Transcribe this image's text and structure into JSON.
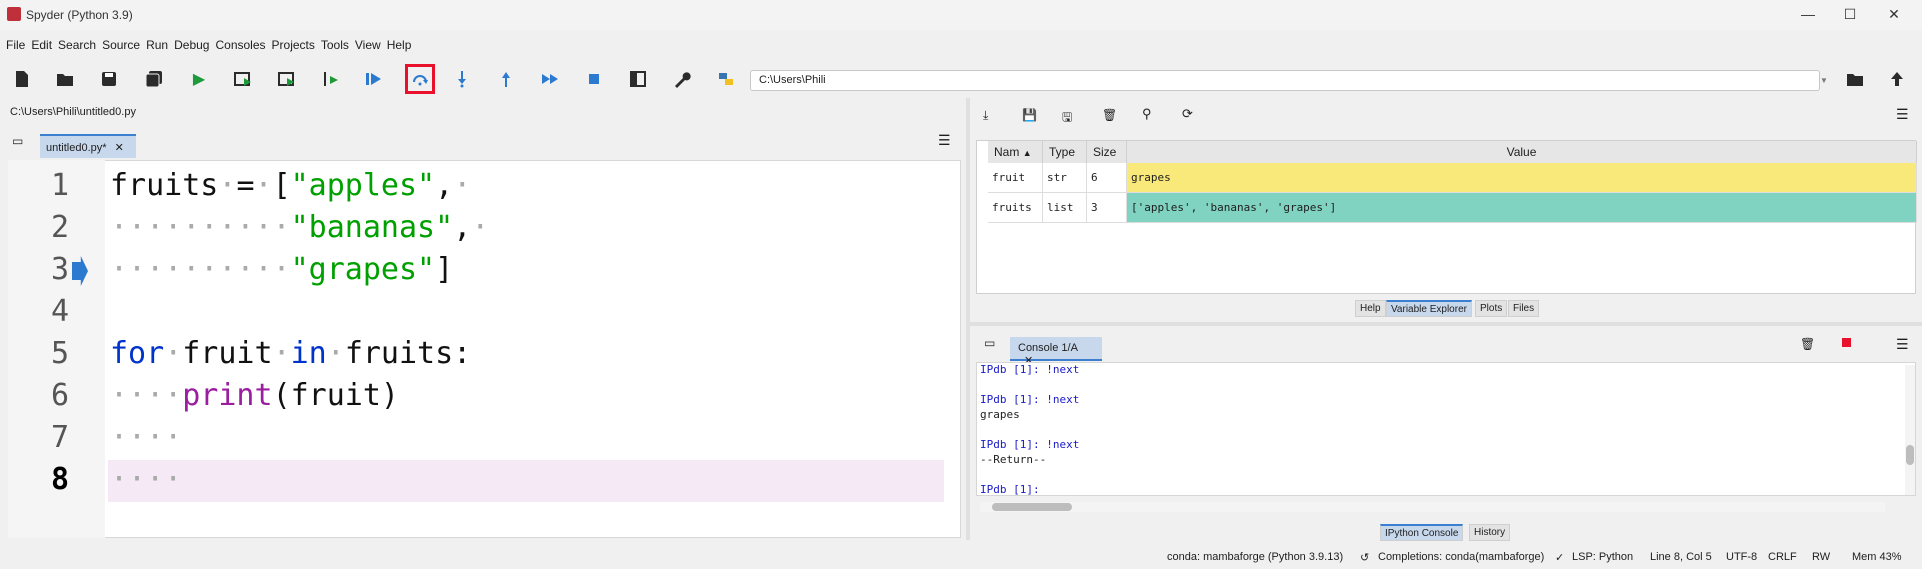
{
  "window": {
    "title": "Spyder (Python 3.9)"
  },
  "menu": [
    "File",
    "Edit",
    "Search",
    "Source",
    "Run",
    "Debug",
    "Consoles",
    "Projects",
    "Tools",
    "View",
    "Help"
  ],
  "toolbar": {
    "path": "C:\\Users\\Phili"
  },
  "editor": {
    "file_path": "C:\\Users\\Phili\\untitled0.py",
    "tab_label": "untitled0.py*",
    "line_numbers": [
      "1",
      "2",
      "3",
      "4",
      "5",
      "6",
      "7",
      "8"
    ]
  },
  "variables": {
    "headers": [
      "Nam",
      "Type",
      "Size",
      "Value"
    ],
    "rows": [
      {
        "name": "fruit",
        "type": "str",
        "size": "6",
        "value": "grapes",
        "color": "#f8e97a"
      },
      {
        "name": "fruits",
        "type": "list",
        "size": "3",
        "value": "['apples', 'bananas', 'grapes']",
        "color": "#7fd3c0"
      }
    ],
    "tabs": [
      "Help",
      "Variable Explorer",
      "Plots",
      "Files"
    ]
  },
  "console": {
    "tab_label": "Console 1/A",
    "lines": [
      "IPdb [1]: !next",
      "IPdb [1]: !next",
      "grapes",
      "IPdb [1]: !next",
      "--Return--",
      "IPdb [1]:"
    ],
    "tabs": [
      "IPython Console",
      "History"
    ]
  },
  "status": {
    "env": "conda: mambaforge (Python 3.9.13)",
    "completions": "Completions: conda(mambaforge)",
    "lsp": "LSP: Python",
    "position": "Line 8, Col 5",
    "encoding": "UTF-8",
    "eol": "CRLF",
    "rw": "RW",
    "mem": "Mem 43%"
  },
  "colors": {
    "highlight": "#e8102a",
    "accent": "#3a7fd0"
  }
}
